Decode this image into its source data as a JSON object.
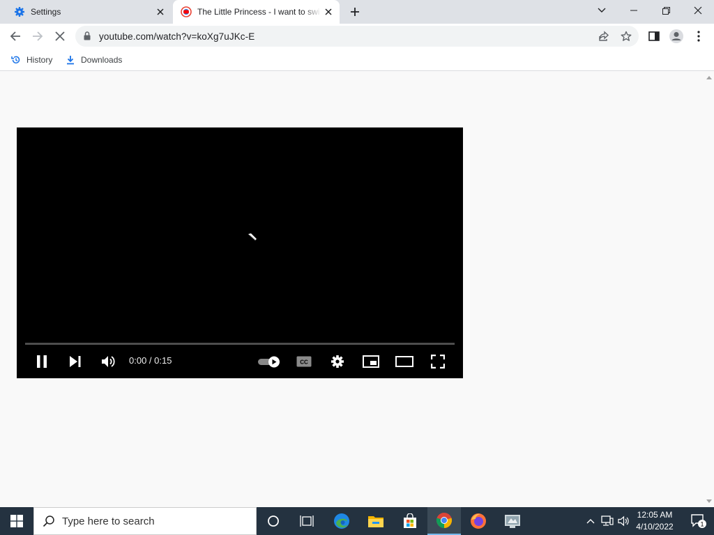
{
  "browser": {
    "tabs": [
      {
        "title": "Settings",
        "icon": "gear-icon",
        "active": false
      },
      {
        "title": "The Little Princess - I want to swi",
        "icon": "youtube-icon",
        "active": true
      }
    ],
    "address": {
      "url": "youtube.com/watch?v=koXg7uJKc-E",
      "icon": "lock-icon"
    },
    "bookmarks": [
      {
        "label": "History",
        "icon": "history-icon"
      },
      {
        "label": "Downloads",
        "icon": "download-icon"
      }
    ]
  },
  "player": {
    "time": "0:00 / 0:15",
    "progress": 0.0,
    "autoplay": true,
    "accent": "#ff0000"
  },
  "taskbar": {
    "search_placeholder": "Type here to search",
    "time": "12:05 AM",
    "date": "4/10/2022",
    "notification_count": "1",
    "pinned": [
      "task-view-icon",
      "edge-icon",
      "file-explorer-icon",
      "store-icon",
      "chrome-icon",
      "firefox-icon",
      "app-icon"
    ]
  }
}
